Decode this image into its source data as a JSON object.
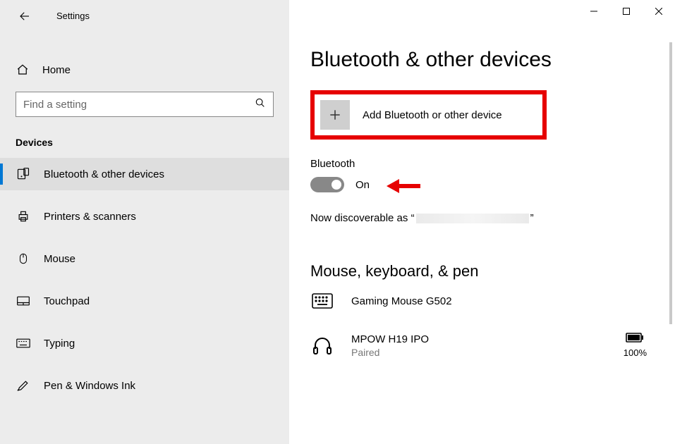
{
  "window": {
    "title": "Settings"
  },
  "sidebar": {
    "home_label": "Home",
    "search_placeholder": "Find a setting",
    "section_title": "Devices",
    "items": [
      {
        "label": "Bluetooth & other devices",
        "icon": "bluetooth-devices",
        "selected": true
      },
      {
        "label": "Printers & scanners",
        "icon": "printer",
        "selected": false
      },
      {
        "label": "Mouse",
        "icon": "mouse",
        "selected": false
      },
      {
        "label": "Touchpad",
        "icon": "touchpad",
        "selected": false
      },
      {
        "label": "Typing",
        "icon": "keyboard",
        "selected": false
      },
      {
        "label": "Pen & Windows Ink",
        "icon": "pen",
        "selected": false
      }
    ]
  },
  "main": {
    "title": "Bluetooth & other devices",
    "add_device_label": "Add Bluetooth or other device",
    "bluetooth_label": "Bluetooth",
    "toggle_state": "On",
    "discover_prefix": "Now discoverable as “",
    "discover_suffix": "”",
    "section_mouse_label": "Mouse, keyboard, & pen",
    "devices": [
      {
        "name": "Gaming Mouse G502",
        "status": "",
        "icon": "keyboard-device",
        "battery": null
      },
      {
        "name": "MPOW H19 IPO",
        "status": "Paired",
        "icon": "headphones",
        "battery": "100%"
      }
    ]
  },
  "annotation": {
    "highlight_color": "#e60000"
  }
}
